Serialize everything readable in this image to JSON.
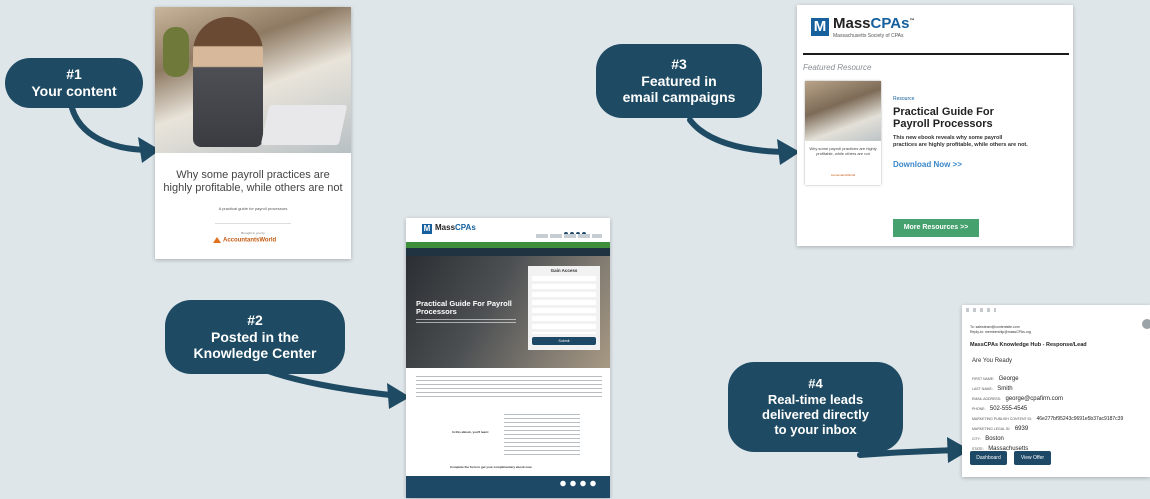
{
  "steps": {
    "s1": {
      "num": "#1",
      "l1": "Your content"
    },
    "s2": {
      "num": "#2",
      "l1": "Posted in the",
      "l2": "Knowledge Center"
    },
    "s3": {
      "num": "#3",
      "l1": "Featured in",
      "l2": "email campaigns"
    },
    "s4": {
      "num": "#4",
      "l1": "Real-time leads",
      "l2": "delivered directly",
      "l3": "to your inbox"
    }
  },
  "ebook": {
    "title1": "Why some payroll practices are",
    "title2": "highly profitable, while others are not",
    "subtitle": "A practical guide for payroll processors",
    "brought_by": "Brought to you by",
    "brand": "AccountantsWorld"
  },
  "email": {
    "logo_word_a": "Mass",
    "logo_word_b": "CPAs",
    "logo_tm": "™",
    "logo_sub": "Massachusetts Society of CPAs",
    "featured": "Featured Resource",
    "resource_tag": "Resource",
    "headline1": "Practical Guide For",
    "headline2": "Payroll Processors",
    "desc1": "This new ebook reveals why some payroll",
    "desc2": "practices are highly profitable, while others are not.",
    "download": "Download Now >>",
    "more": "More Resources >>",
    "thumb_text": "Why some payroll practices are highly profitable, while others are not"
  },
  "knowledge": {
    "page_title1": "Practical Guide For Payroll",
    "page_title2": "Processors",
    "form_title": "Gain Access",
    "submit": "Submit",
    "learn_label": "In this eBook, you'll learn:",
    "cta": "Complete the form to get your complimentary ebook now."
  },
  "lead": {
    "subject": "MassCPAs Knowledge Hub - Response/Lead",
    "ready": "Are You Ready",
    "to": "To: salesteam@contentsite.com",
    "reply": "Reply-to: membership@massCPAs.org",
    "fields": [
      {
        "label": "FIRST NAME:",
        "value": "George"
      },
      {
        "label": "LAST NAME:",
        "value": "Smith"
      },
      {
        "label": "EMAIL ADDRESS:",
        "value": "george@cpafirm.com"
      },
      {
        "label": "PHONE:",
        "value": "502-555-4545"
      },
      {
        "label": "MARKETING PUBLISH CONTENT ID:",
        "value": "46e277bf95243c9691e5b37ac9187c39"
      },
      {
        "label": "MARKETING LEGAL ID:",
        "value": "6939"
      },
      {
        "label": "CITY:",
        "value": "Boston"
      },
      {
        "label": "STATE:",
        "value": "Massachusetts"
      }
    ],
    "dashboard": "Dashboard",
    "view_offer": "View Offer"
  },
  "colors": {
    "navy": "#1e4b63",
    "mass_blue": "#15609d",
    "green": "#45a16e",
    "background": "#dfe6ea"
  }
}
